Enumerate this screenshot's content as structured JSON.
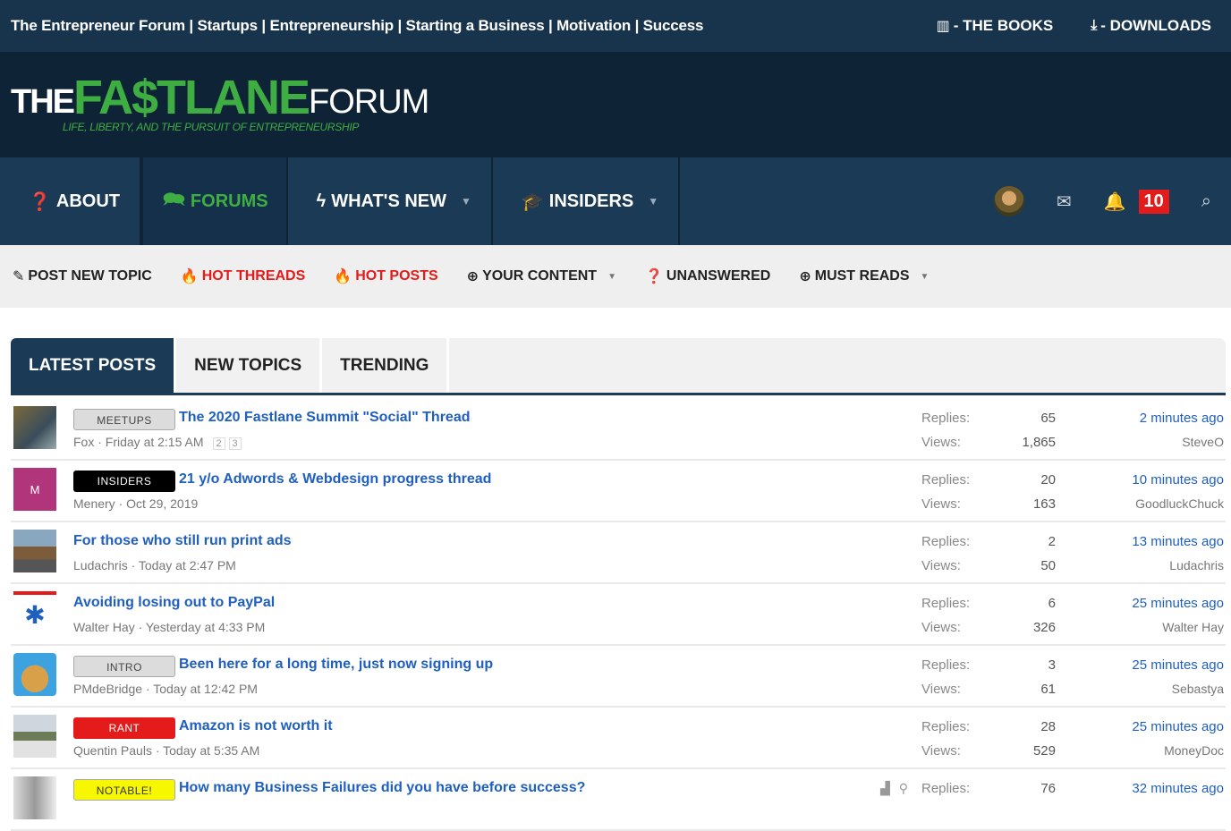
{
  "topbar": {
    "tagline": "The Entrepreneur Forum | Startups | Entrepreneurship | Starting a Business | Motivation | Success",
    "books": "- THE BOOKS",
    "downloads": "- DOWNLOADS"
  },
  "logo": {
    "the": "THE",
    "fastlane": "FA$TLANE",
    "forum": "FORUM",
    "sub": "LIFE, LIBERTY, AND THE PURSUIT OF ENTREPRENEURSHIP"
  },
  "nav": {
    "about": "ABOUT",
    "forums": "FORUMS",
    "whats_new": "WHAT'S NEW",
    "insiders": "INSIDERS",
    "alerts_count": "10"
  },
  "subnav": {
    "post_new_topic": "POST NEW TOPIC",
    "hot_threads": "HOT THREADS",
    "hot_posts": "HOT POSTS",
    "your_content": "YOUR CONTENT",
    "unanswered": "UNANSWERED",
    "must_reads": "MUST READS"
  },
  "tabs": {
    "latest": "LATEST POSTS",
    "new_topics": "NEW TOPICS",
    "trending": "TRENDING"
  },
  "labels": {
    "replies": "Replies:",
    "views": "Views:"
  },
  "threads": [
    {
      "prefix": "MEETUPS",
      "title": "The 2020 Fastlane Summit \"Social\" Thread",
      "author": "Fox · Friday at 2:15 AM",
      "pages": [
        "2",
        "3"
      ],
      "replies": "65",
      "views": "1,865",
      "when": "2 minutes ago",
      "who": "SteveO"
    },
    {
      "prefix": "INSIDERS",
      "title": "21 y/o Adwords & Webdesign progress thread",
      "author": "Menery · Oct 29, 2019",
      "avatar": "M",
      "replies": "20",
      "views": "163",
      "when": "10 minutes ago",
      "who": "GoodluckChuck"
    },
    {
      "title": "For those who still run print ads",
      "author": "Ludachris · Today at 2:47 PM",
      "replies": "2",
      "views": "50",
      "when": "13 minutes ago",
      "who": "Ludachris"
    },
    {
      "title": "Avoiding losing out to PayPal",
      "author": "Walter Hay · Yesterday at 4:33 PM",
      "replies": "6",
      "views": "326",
      "when": "25 minutes ago",
      "who": "Walter Hay"
    },
    {
      "prefix": "INTRO",
      "title": "Been here for a long time, just now signing up",
      "author": "PMdeBridge · Today at 12:42 PM",
      "replies": "3",
      "views": "61",
      "when": "25 minutes ago",
      "who": "Sebastya"
    },
    {
      "prefix": "RANT",
      "title": "Amazon is not worth it",
      "author": "Quentin Pauls · Today at 5:35 AM",
      "replies": "28",
      "views": "529",
      "when": "25 minutes ago",
      "who": "MoneyDoc"
    },
    {
      "prefix": "NOTABLE!",
      "title": "How many Business Failures did you have before success?",
      "author": "",
      "replies": "76",
      "views": "",
      "when": "32 minutes ago",
      "who": ""
    }
  ],
  "icons": {
    "books": "books-icon",
    "downloads": "download-icon",
    "about": "question-circle-icon",
    "forums": "comments-icon",
    "whats_new": "bolt-icon",
    "insiders": "graduation-cap-icon",
    "mail": "envelope-icon",
    "bell": "bell-icon",
    "search": "search-icon",
    "pencil": "pencil-icon",
    "fire": "fire-icon"
  },
  "colors": {
    "navy": "#18344c",
    "dark": "#0f2336",
    "green": "#3fae42",
    "link": "#1f5fbf",
    "red": "#e31b1b"
  }
}
